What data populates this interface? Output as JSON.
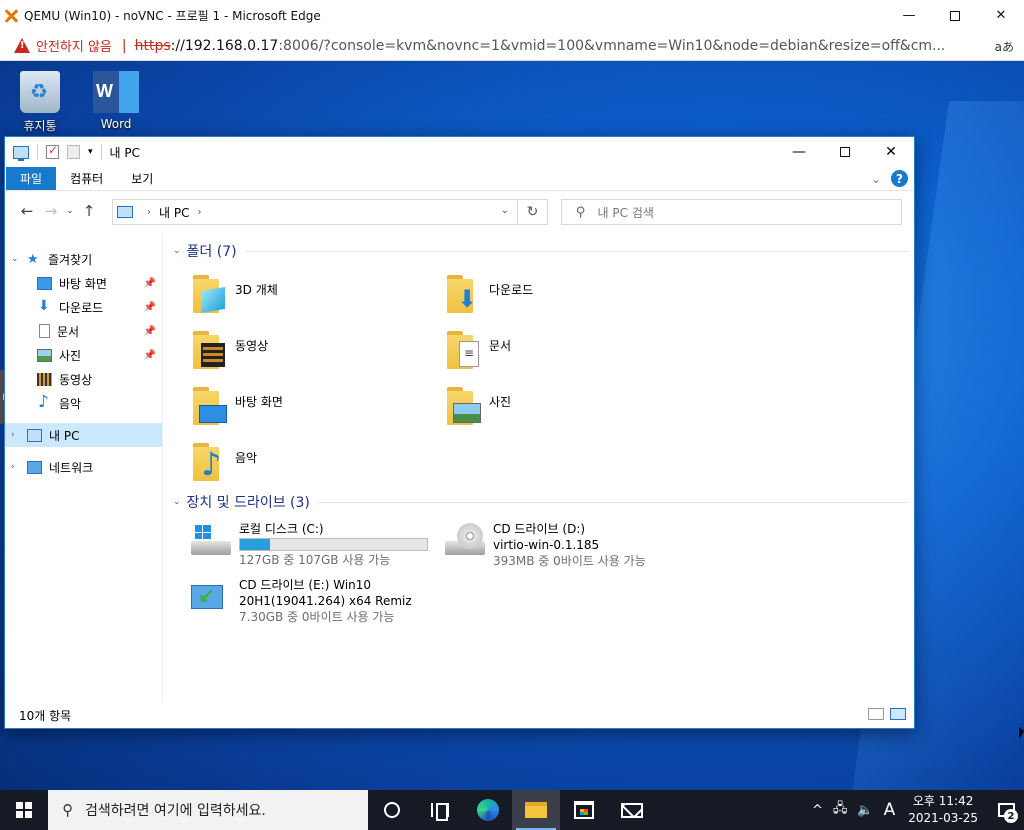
{
  "browser": {
    "title": "QEMU (Win10) - noVNC - 프로필 1 - Microsoft Edge",
    "insecure_label": "안전하지 않음",
    "url_scheme": "https",
    "url_host": "://192.168.0.17",
    "url_rest": ":8006/?console=kvm&novnc=1&vmid=100&vmname=Win10&node=debian&resize=off&cm...",
    "read_aloud": "aあ",
    "controls": {
      "minimize": "—",
      "close": "✕"
    },
    "warn_color": "#c42b1c"
  },
  "desktop": {
    "icons": [
      {
        "label": "휴지통",
        "icon": "recycle-bin-icon"
      },
      {
        "label": "Word",
        "icon": "word-icon"
      }
    ],
    "side_handle": "▶"
  },
  "explorer": {
    "title": "내 PC",
    "ribbon_tabs": [
      "파일",
      "컴퓨터",
      "보기"
    ],
    "ribbon_expand": "⌄",
    "help": "?",
    "nav": {
      "back": "←",
      "forward": "→",
      "recent": "⌄",
      "up": "↑"
    },
    "address": {
      "sep1": "›",
      "location": "내 PC",
      "sep2": "›",
      "dropdown": "⌄",
      "refresh": "↻"
    },
    "search_placeholder": "내 PC 검색",
    "sidebar": {
      "quick_access": "즐겨찾기",
      "items": [
        {
          "label": "바탕 화면",
          "pinned": "📌"
        },
        {
          "label": "다운로드",
          "pinned": "📌"
        },
        {
          "label": "문서",
          "pinned": "📌"
        },
        {
          "label": "사진",
          "pinned": "📌"
        },
        {
          "label": "동영상"
        },
        {
          "label": "음악"
        }
      ],
      "this_pc": "내 PC",
      "network": "네트워크",
      "expand": "›",
      "collapse": "⌄"
    },
    "folders": {
      "header": "폴더 (7)",
      "items": [
        "3D 개체",
        "다운로드",
        "동영상",
        "문서",
        "바탕 화면",
        "사진",
        "음악"
      ]
    },
    "drives": {
      "header": "장치 및 드라이브 (3)",
      "items": [
        {
          "name": "로컬 디스크 (C:)",
          "detail": "127GB 중 107GB 사용 가능",
          "used_fraction": 0.16
        },
        {
          "name": "CD 드라이브 (D:)",
          "line2": "virtio-win-0.1.185",
          "detail": "393MB 중 0바이트 사용 가능"
        },
        {
          "name": "CD 드라이브 (E:) Win10",
          "line2": "20H1(19041.264) x64 Remiz",
          "detail": "7.30GB 중 0바이트 사용 가능"
        }
      ]
    },
    "status": "10개 항목",
    "accent_color": "#1979ca"
  },
  "taskbar": {
    "search_placeholder": "검색하려면 여기에 입력하세요.",
    "tray": {
      "chevron": "^",
      "network": "🖧",
      "volume": "🔈",
      "ime": "A"
    },
    "time": "오후 11:42",
    "date": "2021-03-25",
    "notifications": "2"
  }
}
